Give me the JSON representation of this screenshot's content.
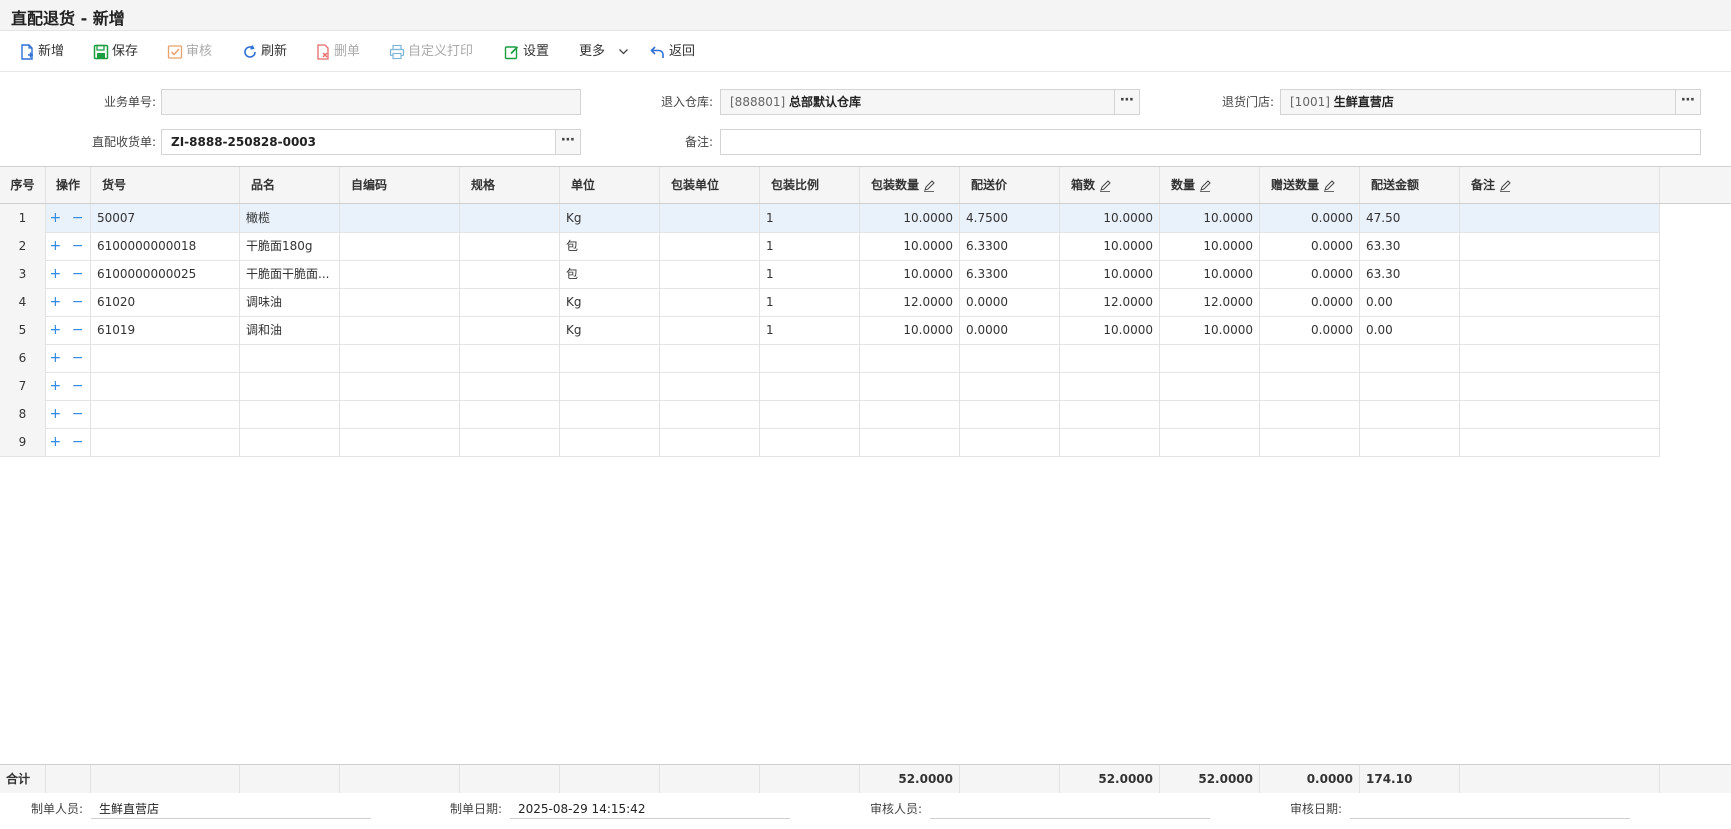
{
  "window": {
    "title": "直配退货 - 新增"
  },
  "toolbar": {
    "new_label": "新增",
    "save_label": "保存",
    "audit_label": "审核",
    "refresh_label": "刷新",
    "delete_label": "删单",
    "print_label": "自定义打印",
    "settings_label": "设置",
    "more_label": "更多",
    "back_label": "返回"
  },
  "form": {
    "bill_no_label": "业务单号:",
    "bill_no_value": "",
    "warehouse_label": "退入仓库:",
    "warehouse_code": "[888801]",
    "warehouse_name": "总部默认仓库",
    "store_label": "退货门店:",
    "store_code": "[1001]",
    "store_name": "生鲜直营店",
    "receipt_label": "直配收货单:",
    "receipt_value": "ZI-8888-250828-0003",
    "remark_label": "备注:",
    "remark_value": ""
  },
  "table": {
    "headers": [
      "序号",
      "操作",
      "货号",
      "品名",
      "自编码",
      "规格",
      "单位",
      "包装单位",
      "包装比例",
      "包装数量",
      "配送价",
      "箱数",
      "数量",
      "赠送数量",
      "配送金额",
      "备注"
    ],
    "ops_symbol": "+ −",
    "rows": [
      {
        "no": "1",
        "code": "50007",
        "name": "橄榄",
        "selfcode": "",
        "spec": "",
        "unit": "Kg",
        "pkg_unit": "",
        "ratio": "1",
        "pkg_qty": "10.0000",
        "price": "4.7500",
        "boxes": "10.0000",
        "qty": "10.0000",
        "gift": "0.0000",
        "amount": "47.50",
        "remark": ""
      },
      {
        "no": "2",
        "code": "6100000000018",
        "name": "干脆面180g",
        "selfcode": "",
        "spec": "",
        "unit": "包",
        "pkg_unit": "",
        "ratio": "1",
        "pkg_qty": "10.0000",
        "price": "6.3300",
        "boxes": "10.0000",
        "qty": "10.0000",
        "gift": "0.0000",
        "amount": "63.30",
        "remark": ""
      },
      {
        "no": "3",
        "code": "6100000000025",
        "name": "干脆面干脆面...",
        "selfcode": "",
        "spec": "",
        "unit": "包",
        "pkg_unit": "",
        "ratio": "1",
        "pkg_qty": "10.0000",
        "price": "6.3300",
        "boxes": "10.0000",
        "qty": "10.0000",
        "gift": "0.0000",
        "amount": "63.30",
        "remark": ""
      },
      {
        "no": "4",
        "code": "61020",
        "name": "调味油",
        "selfcode": "",
        "spec": "",
        "unit": "Kg",
        "pkg_unit": "",
        "ratio": "1",
        "pkg_qty": "12.0000",
        "price": "0.0000",
        "boxes": "12.0000",
        "qty": "12.0000",
        "gift": "0.0000",
        "amount": "0.00",
        "remark": ""
      },
      {
        "no": "5",
        "code": "61019",
        "name": "调和油",
        "selfcode": "",
        "spec": "",
        "unit": "Kg",
        "pkg_unit": "",
        "ratio": "1",
        "pkg_qty": "10.0000",
        "price": "0.0000",
        "boxes": "10.0000",
        "qty": "10.0000",
        "gift": "0.0000",
        "amount": "0.00",
        "remark": ""
      },
      {
        "no": "6",
        "code": "",
        "name": "",
        "selfcode": "",
        "spec": "",
        "unit": "",
        "pkg_unit": "",
        "ratio": "",
        "pkg_qty": "",
        "price": "",
        "boxes": "",
        "qty": "",
        "gift": "",
        "amount": "",
        "remark": ""
      },
      {
        "no": "7",
        "code": "",
        "name": "",
        "selfcode": "",
        "spec": "",
        "unit": "",
        "pkg_unit": "",
        "ratio": "",
        "pkg_qty": "",
        "price": "",
        "boxes": "",
        "qty": "",
        "gift": "",
        "amount": "",
        "remark": ""
      },
      {
        "no": "8",
        "code": "",
        "name": "",
        "selfcode": "",
        "spec": "",
        "unit": "",
        "pkg_unit": "",
        "ratio": "",
        "pkg_qty": "",
        "price": "",
        "boxes": "",
        "qty": "",
        "gift": "",
        "amount": "",
        "remark": ""
      },
      {
        "no": "9",
        "code": "",
        "name": "",
        "selfcode": "",
        "spec": "",
        "unit": "",
        "pkg_unit": "",
        "ratio": "",
        "pkg_qty": "",
        "price": "",
        "boxes": "",
        "qty": "",
        "gift": "",
        "amount": "",
        "remark": ""
      }
    ],
    "totals": {
      "label": "合计",
      "pkg_qty": "52.0000",
      "boxes": "52.0000",
      "qty": "52.0000",
      "gift": "0.0000",
      "amount": "174.10"
    }
  },
  "footer": {
    "creator_label": "制单人员:",
    "creator_value": "生鲜直营店",
    "created_date_label": "制单日期:",
    "created_date_value": "2025-08-29 14:15:42",
    "auditor_label": "审核人员:",
    "auditor_value": "",
    "audit_date_label": "审核日期:",
    "audit_date_value": ""
  },
  "colors": {
    "accent": "#2f8ae0",
    "save_green": "#1a9e3f",
    "audit_orange": "#e9a06a",
    "delete_red": "#e56b6b",
    "selected_row": "#e9f1fb"
  }
}
